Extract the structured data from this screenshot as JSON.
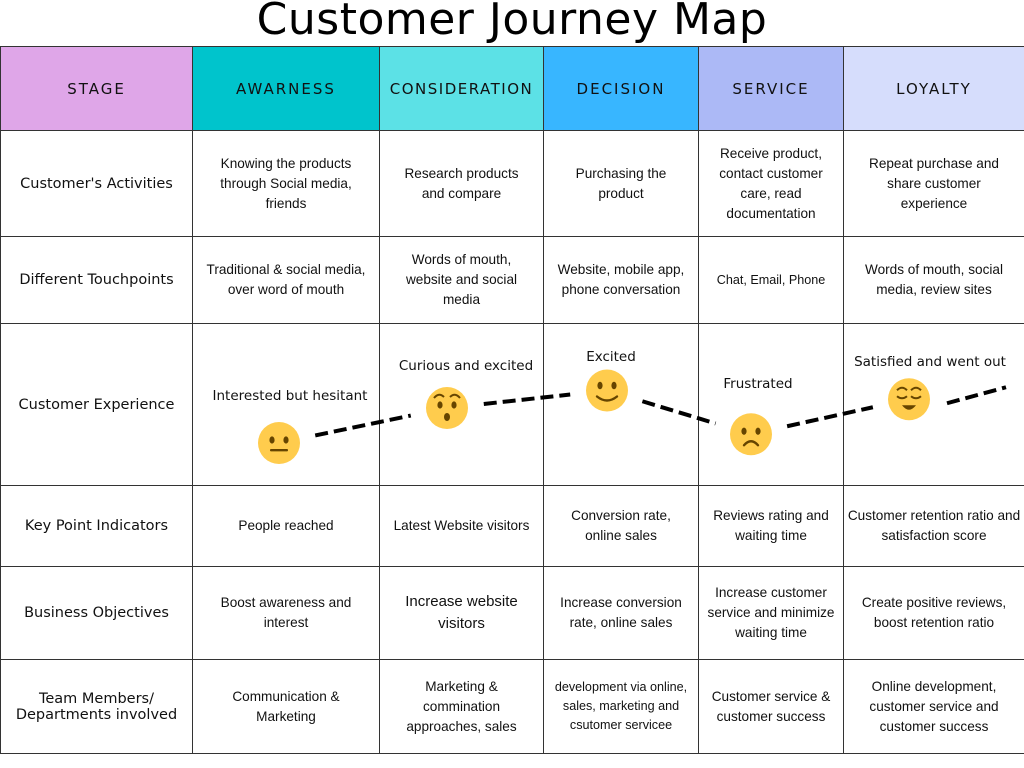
{
  "title": "Customer Journey Map",
  "colors": {
    "stage": "#dfa6e8",
    "awareness": "#00c4cc",
    "consideration": "#5ce1e6",
    "decision": "#38b6ff",
    "service": "#acb9f6",
    "loyalty": "#d6ddfc",
    "emoji_face": "#ffcc4d",
    "emoji_features": "#664500"
  },
  "header": {
    "stage": "STAGE",
    "columns": [
      "AWARNESS",
      "CONSIDERATION",
      "DECISION",
      "SERVICE",
      "LOYALTY"
    ]
  },
  "rows": [
    {
      "label": "Customer's Activities",
      "cells": [
        "Knowing the products through Social media, friends",
        "Research products and compare",
        "Purchasing the product",
        "Receive product, contact customer care, read documentation",
        "Repeat purchase and share customer experience"
      ]
    },
    {
      "label": "Different Touchpoints",
      "cells": [
        "Traditional & social media, over word of mouth",
        "Words of mouth, website and social media",
        "Website, mobile app, phone conversation",
        "Chat, Email, Phone",
        "Words of mouth, social media, review sites"
      ]
    },
    {
      "label": "Customer Experience",
      "emotions": [
        {
          "label": "Interested but hesitant",
          "emoji": "neutral-face",
          "level": 1
        },
        {
          "label": "Curious and excited",
          "emoji": "hushed-face",
          "level": 3
        },
        {
          "label": "Excited",
          "emoji": "slightly-smiling-face",
          "level": 4
        },
        {
          "label": "Frustrated",
          "emoji": "frowning-face",
          "level": 1.5
        },
        {
          "label": "Satisfied and went out",
          "emoji": "relieved-face",
          "level": 3.5
        }
      ]
    },
    {
      "label": "Key Point Indicators",
      "cells": [
        "People reached",
        "Latest Website visitors",
        "Conversion rate, online sales",
        "Reviews rating and waiting time",
        "Customer retention ratio and satisfaction score"
      ]
    },
    {
      "label": "Business Objectives",
      "cells": [
        "Boost awareness and interest",
        "Increase website visitors",
        "Increase conversion rate, online sales",
        "Increase customer service and minimize waiting time",
        "Create positive reviews, boost retention ratio"
      ]
    },
    {
      "label": "Team Members/ Departments involved",
      "cells": [
        "Communication & Marketing",
        "Marketing & commination approaches, sales",
        "development via online, sales, marketing and csutomer servicee",
        "Customer service & customer success",
        "Online development, customer service and customer success"
      ]
    }
  ]
}
